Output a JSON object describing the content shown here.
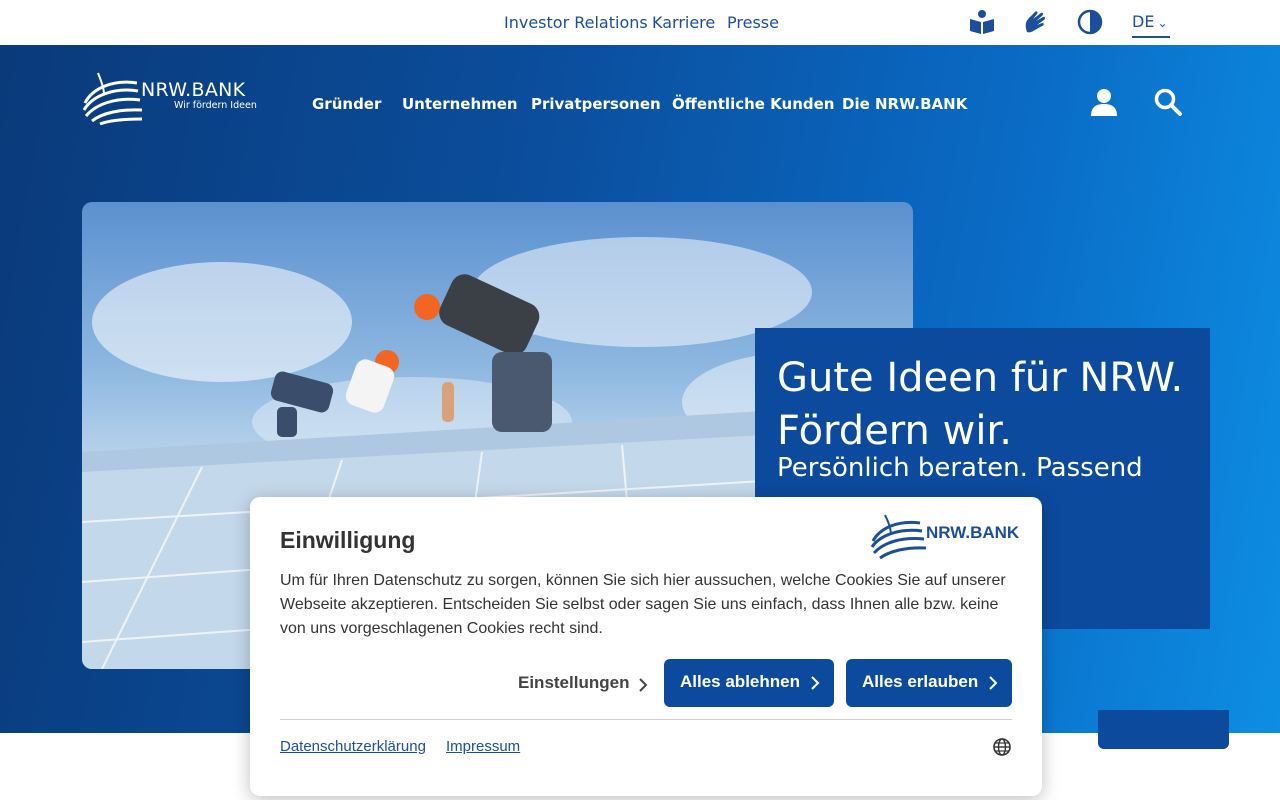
{
  "topbar": {
    "links": [
      "Investor Relations",
      "Karriere",
      "Presse"
    ],
    "icons": [
      "easy-language-icon",
      "sign-language-icon",
      "contrast-icon"
    ],
    "language": "DE"
  },
  "header": {
    "logo_name": "NRW.BANK",
    "logo_claim": "Wir fördern Ideen",
    "nav": [
      "Gründer",
      "Unternehmen",
      "Privatpersonen",
      "Öffentliche Kunden",
      "Die NRW.BANK"
    ]
  },
  "hero": {
    "headline": "Gute Ideen für NRW. Fördern wir.",
    "subline": "Persönlich beraten. Passend"
  },
  "consent": {
    "title": "Einwilligung",
    "text": "Um für Ihren Datenschutz zu sorgen, können Sie sich hier aussuchen, welche Cookies Sie auf unserer Webseite akzeptieren. Entscheiden Sie selbst oder sagen Sie uns einfach, dass Ihnen alle bzw. keine von uns vorgeschlagenen Cookies recht sind.",
    "logo_name": "NRW.BANK",
    "settings_label": "Einstellungen",
    "reject_label": "Alles ablehnen",
    "accept_label": "Alles erlauben",
    "privacy_link": "Datenschutzerklärung",
    "imprint_link": "Impressum"
  },
  "colors": {
    "brand_blue": "#0c4a9e",
    "link_blue": "#1b4f9c"
  }
}
